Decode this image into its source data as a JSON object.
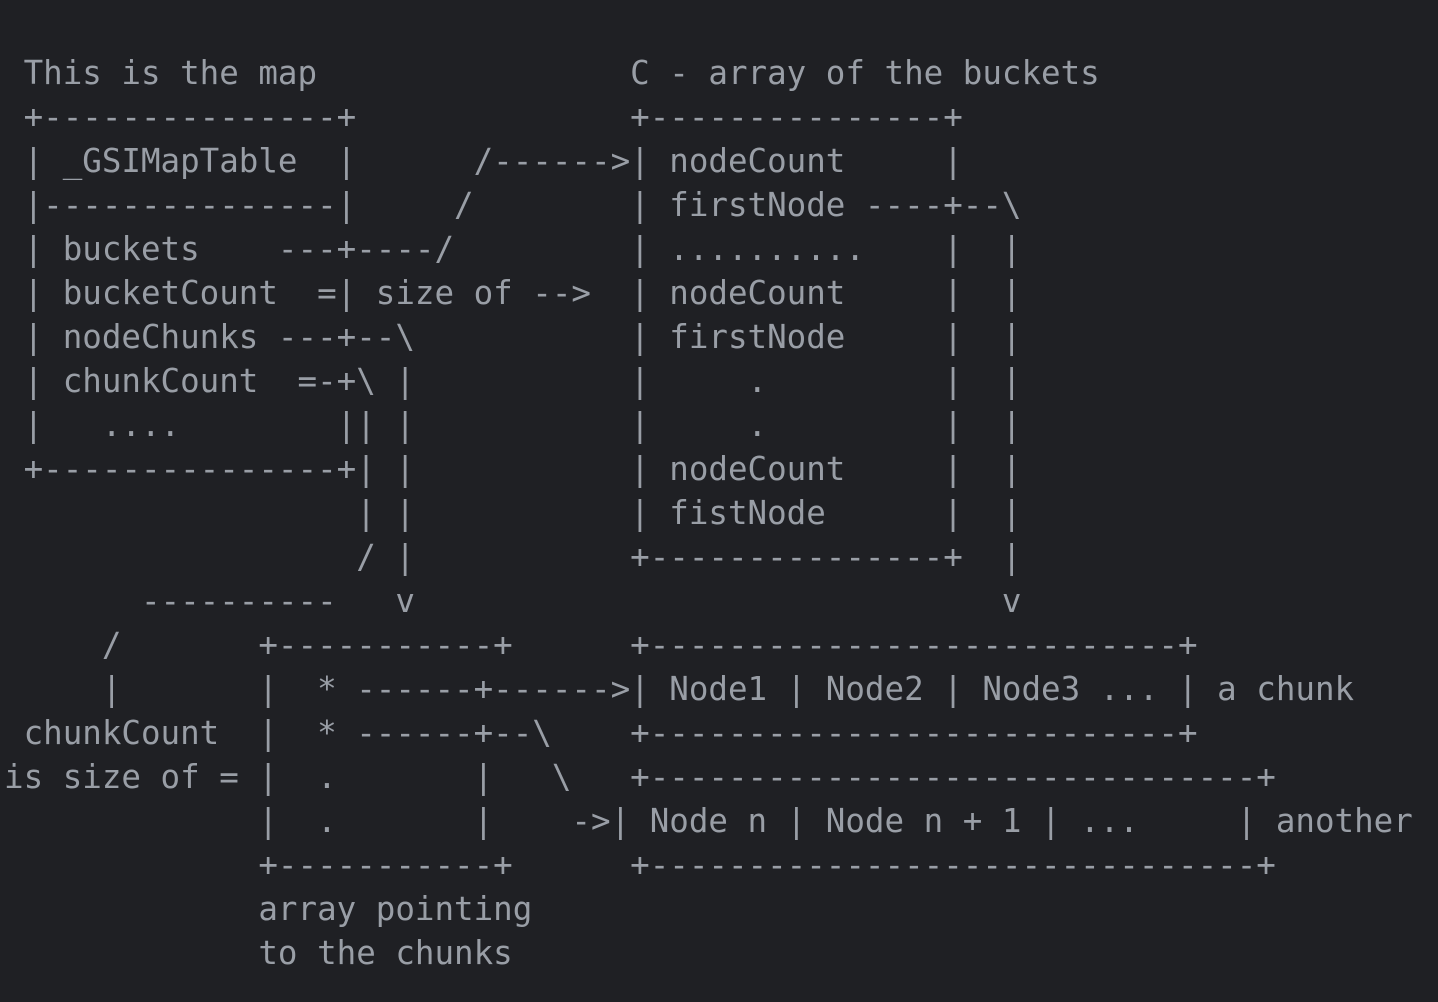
{
  "diagram": {
    "lines": [
      " This is the map                C - array of the buckets",
      " +---------------+              +---------------+",
      " | _GSIMapTable  |      /------>| nodeCount     |",
      " |---------------|     /        | firstNode ----+--\\",
      " | buckets    ---+----/         | ..........    |  |",
      " | bucketCount  =| size of -->  | nodeCount     |  |",
      " | nodeChunks ---+--\\           | firstNode     |  |",
      " | chunkCount  =-+\\ |           |     .         |  |",
      " |   ....        || |           |     .         |  |",
      " +---------------+| |           | nodeCount     |  |",
      "                  | |           | fistNode      |  |",
      "                  / |           +---------------+  |",
      "       ----------   v                              v",
      "     /       +-----------+      +---------------------------+",
      "     |       |  * ------+------>| Node1 | Node2 | Node3 ... | a chunk",
      " chunkCount  |  * ------+--\\    +---------------------------+",
      "is size of = |  .       |   \\   +-------------------------------+",
      "             |  .       |    ->| Node n | Node n + 1 | ...     | another",
      "             +-----------+      +-------------------------------+",
      "             array pointing",
      "             to the chunks"
    ]
  }
}
